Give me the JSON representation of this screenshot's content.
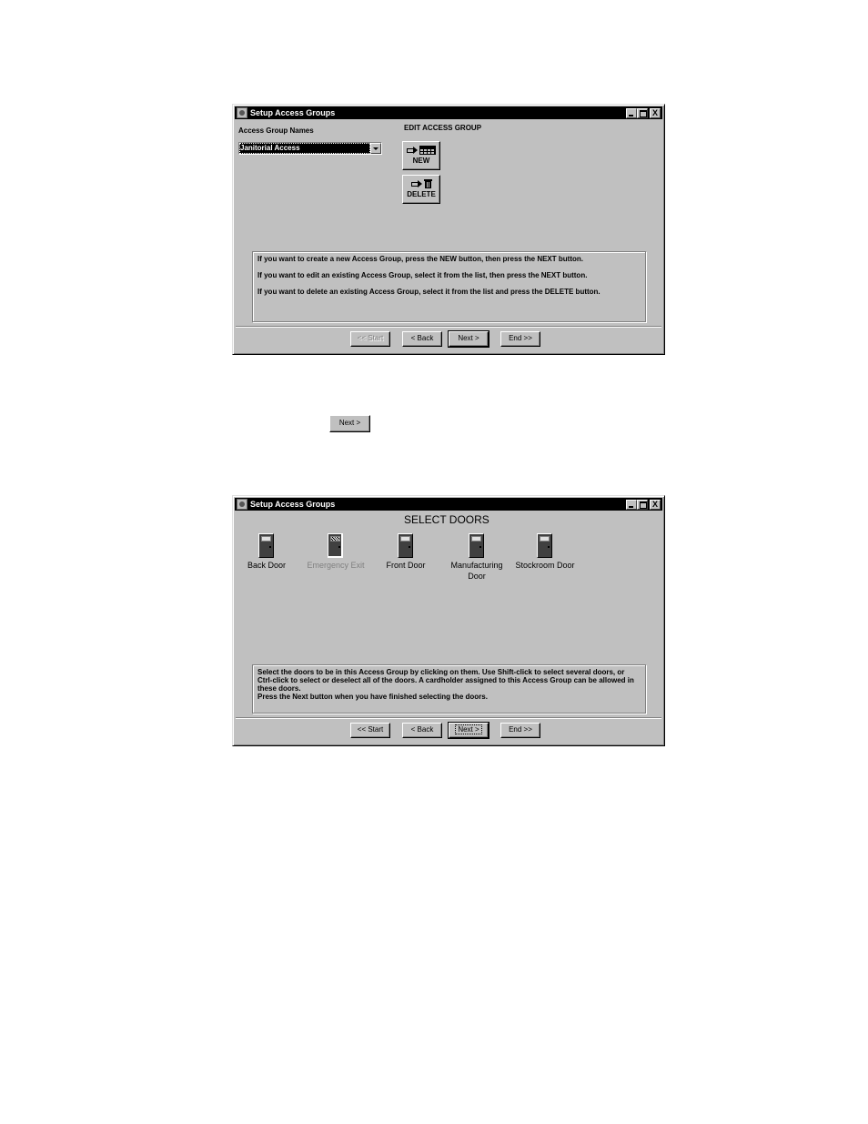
{
  "dialog1": {
    "title": "Setup Access Groups",
    "window_controls": {
      "minimize": "minimize",
      "maximize": "maximize",
      "close": "X"
    },
    "group_names_label": "Access Group Names",
    "group_select": {
      "selected": "Janitorial Access"
    },
    "edit_heading": "EDIT ACCESS GROUP",
    "new_button": {
      "label": "NEW",
      "icons": [
        "arrow-right-icon",
        "grid-icon"
      ]
    },
    "delete_button": {
      "label": "DELETE",
      "icons": [
        "arrow-right-icon",
        "trash-icon"
      ]
    },
    "instructions": [
      "If you want to create a new Access Group, press the NEW button, then press the NEXT button.",
      "If you want to edit an existing Access Group, select it from the list, then press the NEXT button.",
      "If you want to delete an existing Access Group, select it from the list and press the DELETE button."
    ],
    "nav": {
      "start": "<< Start",
      "back": "< Back",
      "next": "Next >",
      "end": "End >>"
    },
    "nav_state": {
      "start_enabled": false,
      "default": "next"
    }
  },
  "standalone_next_button": "Next >",
  "dialog2": {
    "title": "Setup Access Groups",
    "window_controls": {
      "minimize": "minimize",
      "maximize": "maximize",
      "close": "X"
    },
    "heading": "SELECT DOORS",
    "doors": [
      {
        "name": "Back Door",
        "enabled": true
      },
      {
        "name": "Emergency Exit",
        "enabled": false
      },
      {
        "name": "Front Door",
        "enabled": true
      },
      {
        "name": "Manufacturing Door",
        "enabled": true
      },
      {
        "name": "Stockroom Door",
        "enabled": true
      }
    ],
    "instructions": [
      "Select the doors to be in this Access Group by clicking on them.  Use Shift-click to select several doors, or Ctrl-click to select or deselect all of the doors.  A cardholder assigned to this Access Group can be allowed in these doors.",
      "Press the Next button when you have finished selecting the doors."
    ],
    "nav": {
      "start": "<< Start",
      "back": "< Back",
      "next": "Next >",
      "end": "End >>"
    },
    "nav_state": {
      "start_enabled": true,
      "focused": "next"
    }
  }
}
